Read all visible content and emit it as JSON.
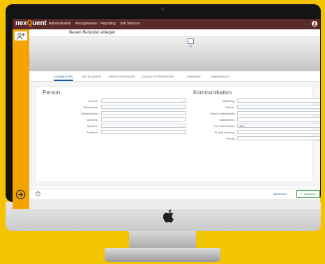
{
  "app": {
    "brand_part1": "nex",
    "brand_part2": "Q",
    "brand_part3": "uent"
  },
  "nav": {
    "items": [
      "Administration",
      "Antragswesen",
      "Reporting",
      "Self Services"
    ]
  },
  "page": {
    "title": "Neuen Benutzer anlegen"
  },
  "tabs": [
    "STAMMDATEN",
    "DETAILDATEN",
    "BERECHTIGUNGEN",
    "LOKALE SYSTEMDATEN",
    "ANHÄNGE",
    "ANMERKUNG"
  ],
  "person": {
    "heading": "Person",
    "fields": [
      {
        "label": "Anrede:",
        "value": "",
        "dropdown": true,
        "required": false
      },
      {
        "label": "Nachname:",
        "value": "",
        "dropdown": false,
        "required": true
      },
      {
        "label": "Geburtsname:",
        "value": "",
        "dropdown": false,
        "required": false
      },
      {
        "label": "Vorname:",
        "value": "",
        "dropdown": false,
        "required": false
      },
      {
        "label": "Sprache:",
        "value": "",
        "dropdown": true,
        "required": false
      },
      {
        "label": "Funktion:",
        "value": "",
        "dropdown": true,
        "required": false
      }
    ]
  },
  "kommunikation": {
    "heading": "Kommunikation",
    "fields": [
      {
        "label": "Abteilung:",
        "value": "",
        "dropdown": false,
        "required": false
      },
      {
        "label": "Telefon:",
        "value": "",
        "dropdown": false,
        "required": false
      },
      {
        "label": "Telefon Nebenstelle:",
        "value": "",
        "dropdown": false,
        "required": false
      },
      {
        "label": "Mobiltelefon:",
        "value": "",
        "dropdown": false,
        "required": false
      },
      {
        "label": "Fax Nebenstelle:",
        "value": "123",
        "dropdown": false,
        "required": false
      },
      {
        "label": "E-Mail Adresse:",
        "value": "",
        "dropdown": false,
        "required": true
      },
      {
        "label": "Firma:",
        "value": "",
        "dropdown": true,
        "required": true
      }
    ]
  },
  "footer": {
    "cancel": "abbrechen",
    "save": "speichern"
  },
  "colors": {
    "accent": "#f3a400",
    "topbar": "#5a2a2b",
    "link": "#1f5fa0",
    "save": "#2f8f3f",
    "background": "#f5c400"
  },
  "icons": {
    "user": "user-icon",
    "add_user": "add-user-icon",
    "forward": "arrow-right-circle-icon",
    "help": "help-icon",
    "apple": "apple-logo-icon"
  }
}
